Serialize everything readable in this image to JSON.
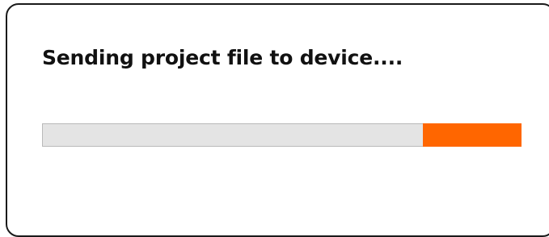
{
  "dialog": {
    "message": "Sending project file to device....",
    "progress": {
      "fill_start_fraction": 0.795,
      "fill_end_fraction": 1.0,
      "fill_color": "#ff6600",
      "track_color": "#e4e4e4"
    }
  }
}
